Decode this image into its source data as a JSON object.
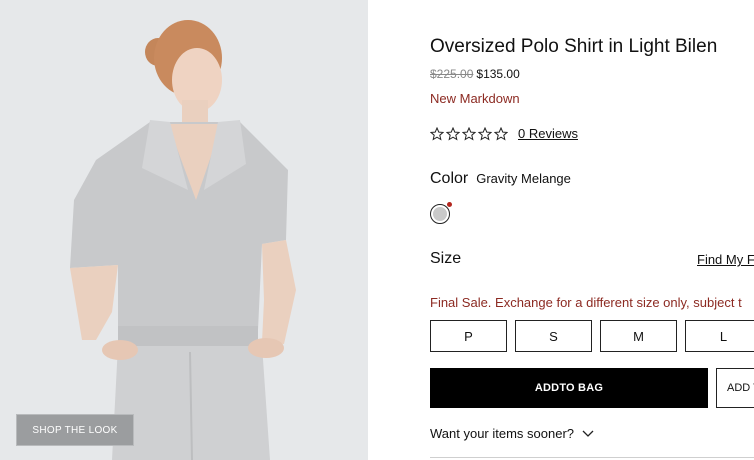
{
  "image": {
    "shop_the_look": "SHOP THE LOOK",
    "background": "#e6e8ea",
    "garment_color": "#c8c9cb"
  },
  "product": {
    "title": "Oversized Polo Shirt in Light Bilen",
    "original_price": "$225.00",
    "sale_price": "$135.00",
    "markdown_label": "New Markdown",
    "accent_color": "#8c2a22"
  },
  "rating": {
    "stars_filled": 0,
    "stars_total": 5,
    "star_icons": [
      "star-outline-icon",
      "star-outline-icon",
      "star-outline-icon",
      "star-outline-icon",
      "star-outline-icon"
    ],
    "reviews_link": "0 Reviews"
  },
  "color": {
    "label": "Color",
    "value": "Gravity Melange",
    "swatch_color": "#c9c9c9",
    "swatch_dot_color": "#b3261e"
  },
  "size": {
    "label": "Size",
    "find_fit_link": "Find My F",
    "final_sale_notice": "Final Sale. Exchange for a different size only, subject t",
    "options": [
      "P",
      "S",
      "M",
      "L"
    ]
  },
  "actions": {
    "add_to_bag": "ADDTO BAG",
    "secondary": "ADD T",
    "delivery_toggle": "Want your items sooner?",
    "delivery_icon": "chevron-down-icon"
  }
}
